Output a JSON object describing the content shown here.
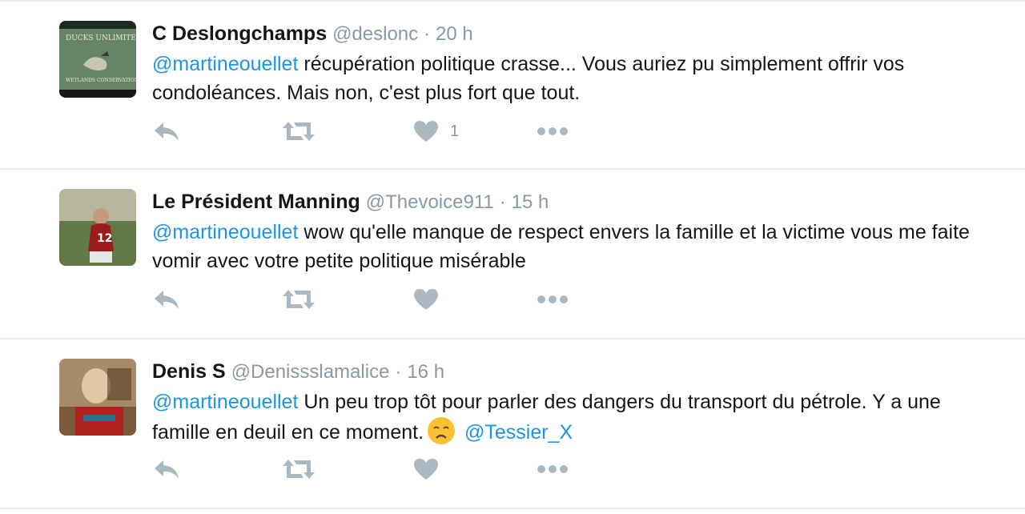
{
  "tweets": [
    {
      "name": "C Deslongchamps",
      "handle": "@deslonc",
      "time": "20 h",
      "mention": "@martineouellet",
      "text": " récupération politique crasse... Vous auriez pu simplement offrir vos condoléances. Mais non, c'est plus fort que tout.",
      "like_count": "1",
      "avatar_icon": "ducks-unlimited-sign-avatar"
    },
    {
      "name": "Le Président Manning",
      "handle": "@Thevoice911",
      "time": "15 h",
      "mention": "@martineouellet",
      "text": " wow qu'elle manque de respect envers la famille et la victime vous me faite vomir avec votre petite politique misérable",
      "like_count": "",
      "avatar_icon": "football-player-avatar"
    },
    {
      "name": "Denis S",
      "handle": "@Denissslamalice",
      "time": "16 h",
      "mention": "@martineouellet",
      "text": " Un peu trop tôt pour parler des dangers du transport du pétrole. Y a une famille en deuil en ce moment.",
      "emoji": "disappointed-face-emoji",
      "trailing_mention": "@Tessier_X",
      "like_count": "",
      "avatar_icon": "person-photo-avatar"
    }
  ],
  "separator": "·",
  "colors": {
    "mention": "#1b95e0",
    "meta": "#8899a6",
    "action_icon": "#aab8c2",
    "divider": "#e6ecf0"
  }
}
